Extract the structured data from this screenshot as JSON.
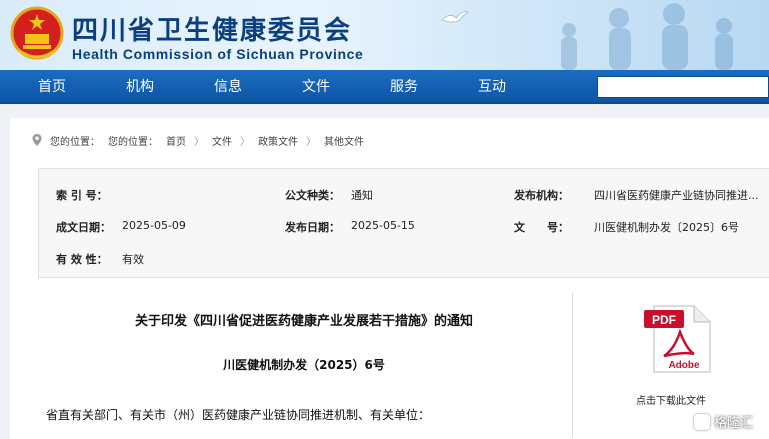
{
  "header": {
    "title": "四川省卫生健康委员会",
    "subtitle": "Health Commission of Sichuan Province"
  },
  "nav": {
    "items": [
      "首页",
      "机构",
      "信息",
      "文件",
      "服务",
      "互动"
    ],
    "search_value": ""
  },
  "breadcrumb": {
    "prefix": "您的位置：",
    "label": "您的位置：",
    "items": [
      "首页",
      "文件",
      "政策文件",
      "其他文件"
    ],
    "separator": "〉"
  },
  "meta": {
    "index_label": "索 引 号：",
    "index_value": "",
    "type_label": "公文种类：",
    "type_value": "通知",
    "issuer_label": "发布机构：",
    "issuer_value": "四川省医药健康产业链协同推进...",
    "created_label": "成文日期：",
    "created_value": "2025-05-09",
    "published_label": "发布日期：",
    "published_value": "2025-05-15",
    "docno_label": "文　　号：",
    "docno_value": "川医健机制办发〔2025〕6号",
    "valid_label": "有 效 性：",
    "valid_value": "有效"
  },
  "document": {
    "title": "关于印发《四川省促进医药健康产业发展若干措施》的通知",
    "number": "川医健机制办发（2025）6号",
    "salutation": "省直有关部门、有关市（州）医药健康产业链协同推进机制、有关单位："
  },
  "download": {
    "pdf_label": "PDF",
    "adobe_label": "Adobe",
    "caption": "点击下载此文件"
  },
  "watermark": {
    "text": "格隆汇"
  },
  "colors": {
    "nav_blue": "#0d56a6",
    "title_blue": "#0b3f7f",
    "pdf_red": "#c8102e"
  }
}
